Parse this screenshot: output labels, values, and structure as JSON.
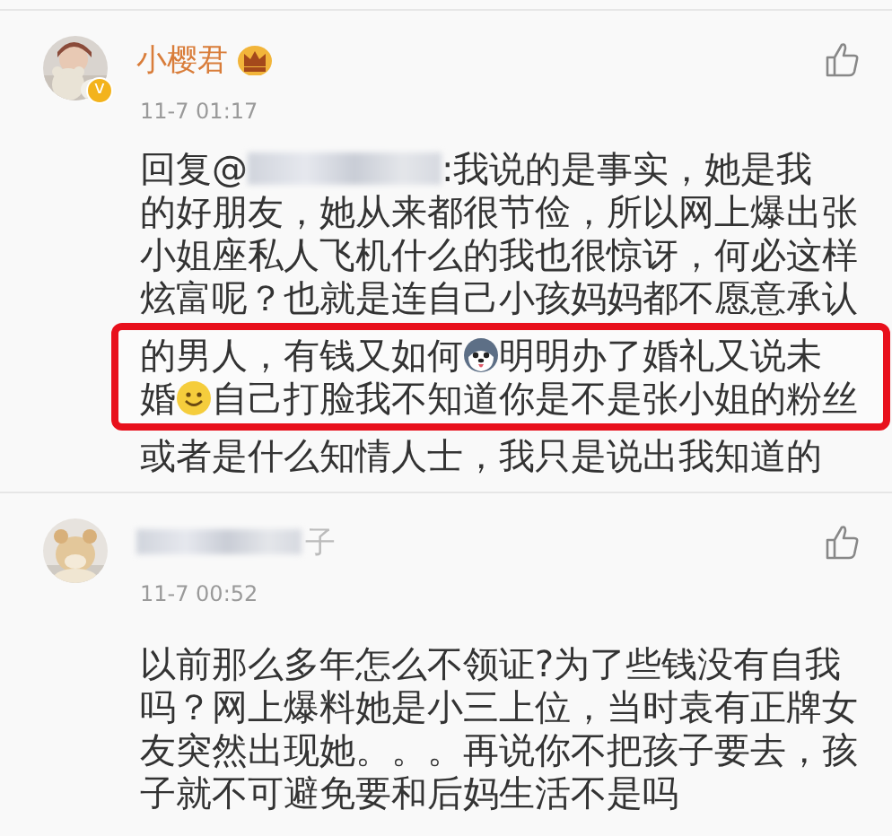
{
  "comments": [
    {
      "name": "小樱君",
      "name_redacted": false,
      "crown": true,
      "verified_badge": "v",
      "time": "11-7 01:17",
      "lines": [
        {
          "highlighted": false,
          "segments": [
            {
              "kind": "text",
              "text": "回复@"
            },
            {
              "kind": "redacted"
            },
            {
              "kind": "text",
              "text": ":我说的是事实，她是我"
            }
          ]
        },
        {
          "highlighted": false,
          "segments": [
            {
              "kind": "text",
              "text": "的好朋友，她从来都很节俭，所以网上爆出张"
            }
          ]
        },
        {
          "highlighted": false,
          "segments": [
            {
              "kind": "text",
              "text": "小姐座私人飞机什么的我也很惊讶，何必这样"
            }
          ]
        },
        {
          "highlighted": false,
          "segments": [
            {
              "kind": "text",
              "text": "炫富呢？也就是连自己小孩妈妈都不愿意承认"
            }
          ]
        },
        {
          "highlighted": true,
          "segments": [
            {
              "kind": "text",
              "text": "的男人，有钱又如何"
            },
            {
              "kind": "husky"
            },
            {
              "kind": "text",
              "text": "明明办了婚礼又说未"
            }
          ]
        },
        {
          "highlighted": true,
          "segments": [
            {
              "kind": "text",
              "text": "婚"
            },
            {
              "kind": "smile"
            },
            {
              "kind": "text",
              "text": "自己打脸我不知道你是不是张小姐的粉丝"
            }
          ]
        },
        {
          "highlighted": false,
          "segments": [
            {
              "kind": "text",
              "text": "或者是什么知情人士，我只是说出我知道的"
            }
          ]
        }
      ]
    },
    {
      "name": "子",
      "name_redacted": true,
      "crown": false,
      "time": "11-7 00:52",
      "lines": [
        {
          "highlighted": false,
          "segments": [
            {
              "kind": "text",
              "text": "以前那么多年怎么不领证?为了些钱没有自我"
            }
          ]
        },
        {
          "highlighted": false,
          "segments": [
            {
              "kind": "text",
              "text": "吗？网上爆料她是小三上位，当时袁有正牌女"
            }
          ]
        },
        {
          "highlighted": false,
          "segments": [
            {
              "kind": "text",
              "text": "友突然出现她。。。再说你不把孩子要去，孩"
            }
          ]
        },
        {
          "highlighted": false,
          "segments": [
            {
              "kind": "text",
              "text": "子就不可避免要和后妈生活不是吗"
            }
          ]
        }
      ]
    }
  ]
}
